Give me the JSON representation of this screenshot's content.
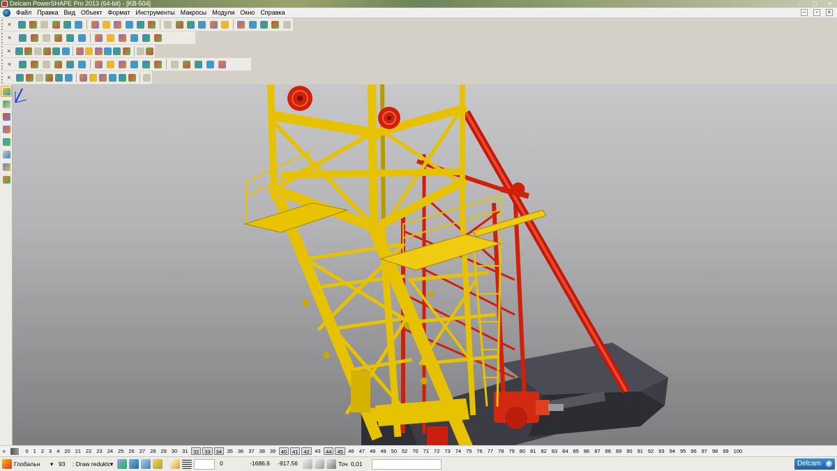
{
  "window": {
    "title": "Delcam PowerSHAPE Pro 2013 (64-bit) - [KB-504]",
    "minimize": "–",
    "maximize": "□",
    "close": "×"
  },
  "menu": {
    "items": [
      "Файл",
      "Правка",
      "Вид",
      "Объект",
      "Формат",
      "Инструменты",
      "Макросы",
      "Модули",
      "Окно",
      "Справка"
    ],
    "mdi_minimize": "–",
    "mdi_restore": "▫",
    "mdi_close": "×"
  },
  "toolbars": {
    "close_glyph": "×",
    "row1_icons": [
      "new-icon",
      "open-icon",
      "open-folder-icon",
      "save-icon",
      "print-icon",
      "cut-icon",
      "copy-icon",
      "paste-icon",
      "brush-icon",
      "delete-icon",
      "undo-icon",
      "redo-icon",
      "select-icon",
      "zoom-icon",
      "arrow-left-icon",
      "arrow-right-icon",
      "circle-icon",
      "curve-icon",
      "line-icon",
      "fill-icon",
      "shaded-icon",
      "wireframe-icon",
      "tool-icon"
    ],
    "row2_icons": [
      "view-iso-1-icon",
      "view-iso-2-icon",
      "view-iso-3-icon",
      "view-select-icon",
      "view-rotate-icon",
      "pan-icon",
      "zoom-in-icon",
      "zoom-box-icon",
      "zoom-all-icon",
      "sphere-icon",
      "shaded-icon",
      "material-icon",
      "light-icon",
      "hand-icon"
    ],
    "row3_icons": [
      "grid-icon",
      "doc-icon",
      "disc-icon",
      "ball-icon",
      "red-ball-icon",
      "play-icon",
      "triangle-icon",
      "box-icon",
      "frame-icon",
      "info-icon",
      "hex-icon",
      "star-icon"
    ],
    "row4_icons": [
      "surface-1-icon",
      "surface-2-icon",
      "surface-3-icon",
      "surface-4-icon",
      "surface-5-icon",
      "surface-6-icon",
      "surface-7-icon",
      "surface-8-icon",
      "surface-9-icon",
      "surface-10-icon",
      "surface-11-icon",
      "surface-12-icon",
      "surface-13-icon",
      "surface-14-icon",
      "surface-15-icon",
      "surface-16-icon",
      "surface-17-icon"
    ],
    "row5_icons": [
      "solid-1-icon",
      "solid-2-icon",
      "solid-3-icon",
      "solid-4-icon",
      "solid-5-icon",
      "solid-6-icon",
      "solid-7-icon",
      "solid-8-icon",
      "solid-9-icon",
      "solid-10-icon",
      "solid-11-icon",
      "solid-12-icon",
      "solid-13-icon"
    ],
    "left_icons": [
      "pointer-icon",
      "grid-select-icon",
      "solid-select-icon",
      "cube-icon",
      "plane-icon",
      "cylinder-icon",
      "arc-icon",
      "sphere-icon"
    ]
  },
  "levels": {
    "items": [
      "0",
      "1",
      "2",
      "3",
      "4",
      "20",
      "21",
      "22",
      "23",
      "24",
      "25",
      "26",
      "27",
      "28",
      "29",
      "30",
      "31",
      "32",
      "33",
      "34",
      "35",
      "36",
      "37",
      "38",
      "39",
      "40",
      "41",
      "42",
      "43",
      "44",
      "45",
      "46",
      "47",
      "48",
      "49",
      "50",
      "52",
      "70",
      "71",
      "72",
      "73",
      "74",
      "75",
      "76",
      "77",
      "78",
      "79",
      "80",
      "81",
      "82",
      "83",
      "84",
      "85",
      "86",
      "87",
      "88",
      "89",
      "90",
      "91",
      "92",
      "93",
      "94",
      "95",
      "96",
      "97",
      "98",
      "99",
      "100"
    ],
    "active": [
      "32",
      "33",
      "34",
      "40",
      "41",
      "42",
      "44",
      "45"
    ],
    "close_glyph": "×"
  },
  "status": {
    "workplane": "Глобальн",
    "workplane_arrow": "▾",
    "level_number": "93",
    "level_name": ": Draw reduktc",
    "level_arrow": "▾",
    "coord_value": "0",
    "x": "-1686,6",
    "y": "-917,56",
    "tolerance_label": "Точ",
    "tolerance_value": "0,01",
    "logo": "Delcam"
  },
  "colors": {
    "tower_yellow": "#e6c200",
    "tower_dark_yellow": "#a38600",
    "ladder_red": "#d0200a",
    "base_gray": "#3c3d44",
    "viewport_top": "#c8c8ca",
    "viewport_bottom": "#7d7d80"
  }
}
